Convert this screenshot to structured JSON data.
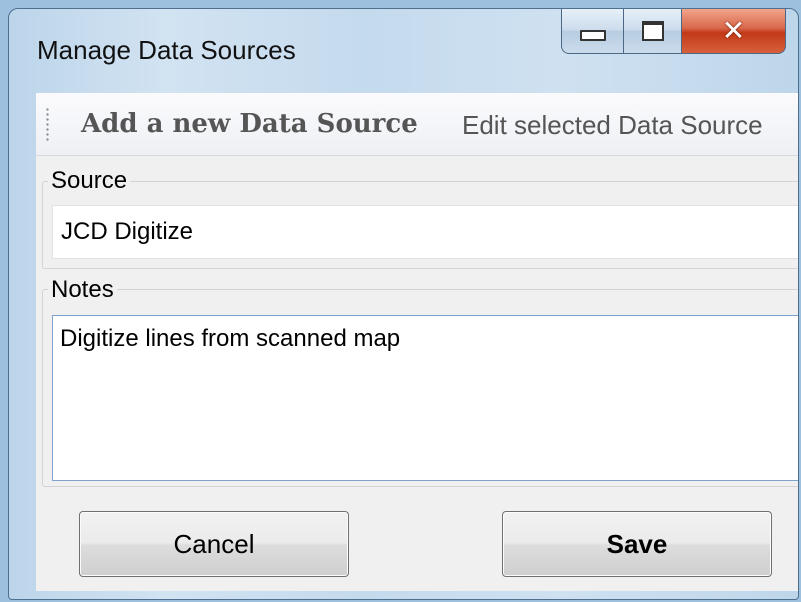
{
  "window": {
    "title": "Manage Data Sources",
    "minimize_label": "Minimize",
    "maximize_label": "Maximize",
    "close_label": "Close"
  },
  "toolbar": {
    "add_label": "Add a new Data Source",
    "edit_label": "Edit selected Data Source"
  },
  "source": {
    "label": "Source",
    "value": "JCD Digitize"
  },
  "notes": {
    "label": "Notes",
    "value": "Digitize lines from scanned map"
  },
  "buttons": {
    "cancel_label": "Cancel",
    "save_label": "Save"
  },
  "colors": {
    "close_button": "#c84a2c",
    "window_frame": "#c4daed",
    "notes_border_focus": "#7da2ce"
  },
  "icons": {
    "minimize": "minimize-icon",
    "maximize": "maximize-icon",
    "close": "close-icon",
    "toolbar_grip": "grip-icon"
  }
}
